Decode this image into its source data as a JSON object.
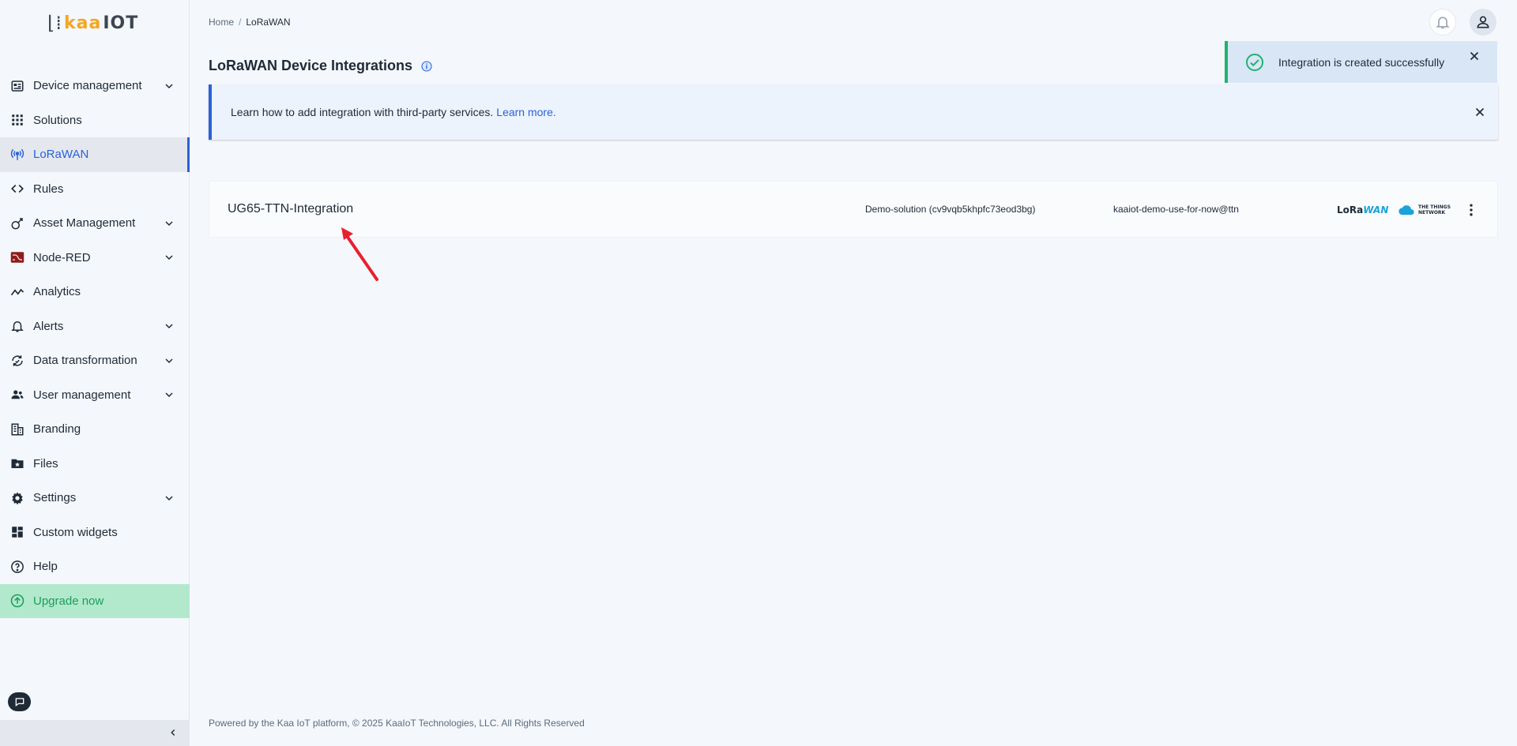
{
  "brand": {
    "logo_prefix": "⌊⁞",
    "logo_kaa": "kaa",
    "logo_iot": "IOT"
  },
  "sidebar": {
    "items": [
      {
        "label": "Device management",
        "icon": "device-icon",
        "expandable": true
      },
      {
        "label": "Solutions",
        "icon": "grid-icon",
        "expandable": false
      },
      {
        "label": "LoRaWAN",
        "icon": "antenna-icon",
        "expandable": false,
        "active": true
      },
      {
        "label": "Rules",
        "icon": "code-icon",
        "expandable": false
      },
      {
        "label": "Asset Management",
        "icon": "asset-icon",
        "expandable": true
      },
      {
        "label": "Node-RED",
        "icon": "node-red-icon",
        "expandable": true
      },
      {
        "label": "Analytics",
        "icon": "analytics-icon",
        "expandable": false
      },
      {
        "label": "Alerts",
        "icon": "bell-icon",
        "expandable": true
      },
      {
        "label": "Data transformation",
        "icon": "transform-icon",
        "expandable": true
      },
      {
        "label": "User management",
        "icon": "users-icon",
        "expandable": true
      },
      {
        "label": "Branding",
        "icon": "building-icon",
        "expandable": false
      },
      {
        "label": "Files",
        "icon": "folder-icon",
        "expandable": false
      },
      {
        "label": "Settings",
        "icon": "gear-icon",
        "expandable": true
      },
      {
        "label": "Custom widgets",
        "icon": "widgets-icon",
        "expandable": false
      },
      {
        "label": "Help",
        "icon": "help-icon",
        "expandable": false
      },
      {
        "label": "Upgrade now",
        "icon": "upgrade-icon",
        "expandable": false
      }
    ]
  },
  "breadcrumb": {
    "home": "Home",
    "separator": "/",
    "current": "LoRaWAN"
  },
  "page": {
    "title": "LoRaWAN Device Integrations"
  },
  "toast": {
    "message": "Integration is created successfully"
  },
  "banner": {
    "text": "Learn how to add integration with third-party services.",
    "link": "Learn more."
  },
  "integration": {
    "name": "UG65-TTN-Integration",
    "solution": "Demo-solution (cv9vqb5khpfc73eod3bg)",
    "account": "kaaiot-demo-use-for-now@ttn",
    "lorawan_logo_lo": "LoRa",
    "lorawan_logo_wan": "WAN",
    "ttn_logo_line1": "THE THINGS",
    "ttn_logo_line2": "NETWORK"
  },
  "footer": {
    "text": "Powered by the Kaa IoT platform, © 2025 KaaIoT Technologies, LLC. All Rights Reserved"
  },
  "colors": {
    "accent": "#2a62d8",
    "success": "#1fb36f",
    "upgrade_bg": "#b2e9cc",
    "annotation": "#e8212e"
  }
}
